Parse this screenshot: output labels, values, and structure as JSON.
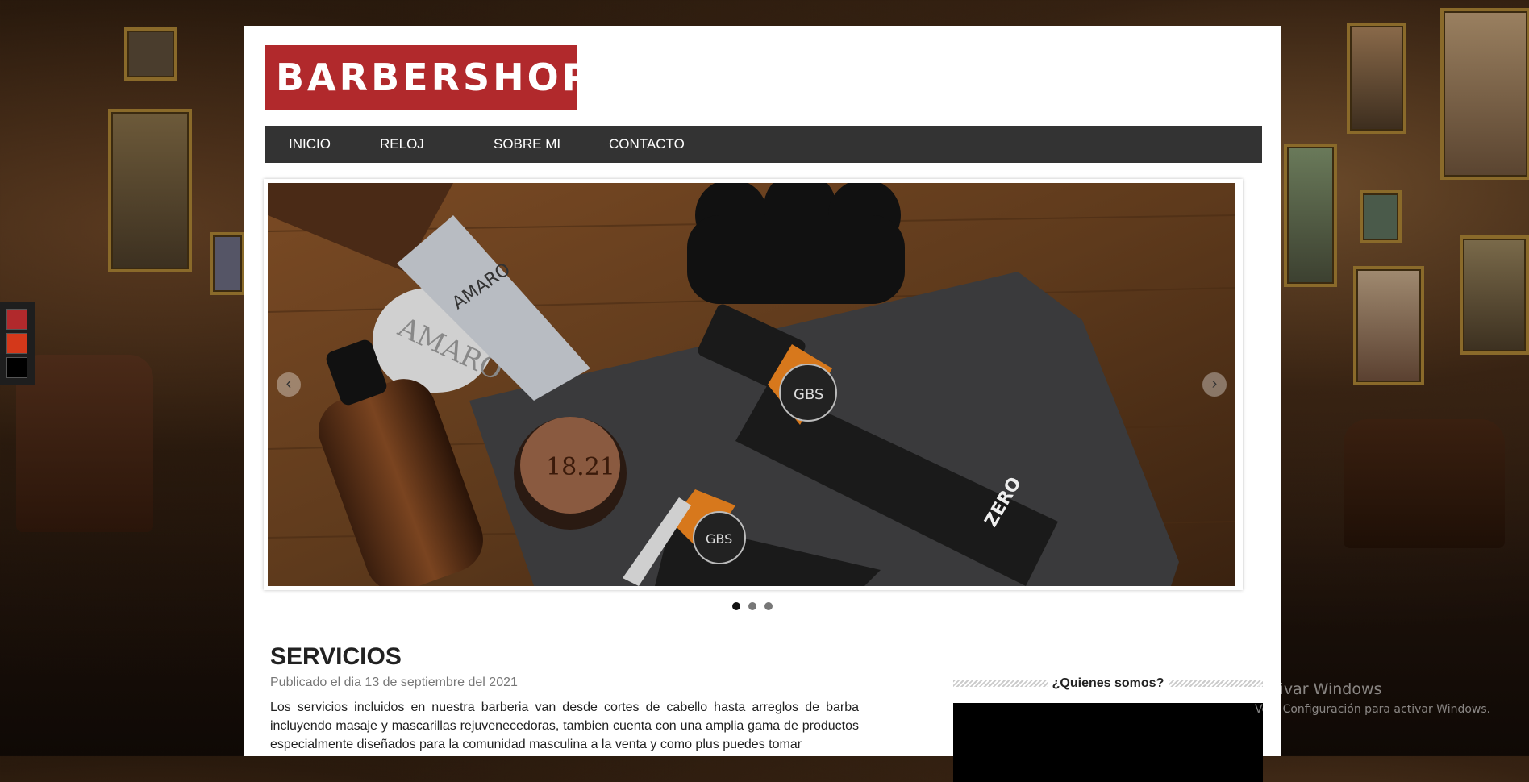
{
  "brand": {
    "logo_text": "BARBERSHOP",
    "color": "#b1292c"
  },
  "nav": {
    "items": [
      "INICIO",
      "RELOJ",
      "SOBRE MI",
      "CONTACTO"
    ]
  },
  "color_switcher": {
    "colors": [
      "#b1292c",
      "#d4381a",
      "#000000"
    ]
  },
  "slider": {
    "prev_icon": "chevron-left-icon",
    "next_icon": "chevron-right-icon",
    "prev_glyph": "‹",
    "next_glyph": "›",
    "image_subject": "barber products and hair clippers on wooden table",
    "product_labels": [
      "AMARO",
      "GBS",
      "ZERO",
      "18.21"
    ],
    "active_slide": 1,
    "slide_count": 3
  },
  "post": {
    "title": "SERVICIOS",
    "date": "Publicado el dia 13 de septiembre del 2021",
    "body": "Los servicios incluidos en nuestra barberia van desde cortes de cabello hasta arreglos de barba incluyendo masaje y mascarillas rejuvenecedoras, tambien cuenta con una amplia gama de productos especialmente diseñados para la comunidad masculina a la venta y como plus puedes tomar"
  },
  "sidebar": {
    "widget_title": "¿Quienes somos?"
  },
  "watermark": {
    "line1": "Activar Windows",
    "line2": "Ve a Configuración para activar Windows."
  }
}
